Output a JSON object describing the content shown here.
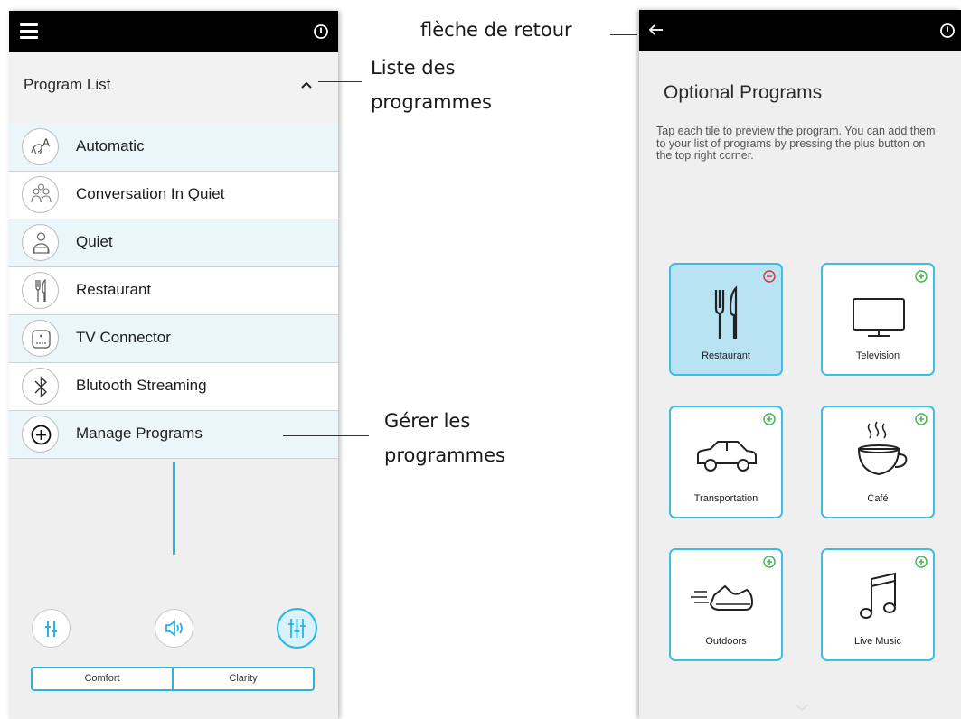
{
  "left_screen": {
    "program_list_title": "Program List",
    "programs": [
      {
        "label": "Automatic",
        "icon": "automatic-icon"
      },
      {
        "label": "Conversation In Quiet",
        "icon": "conversation-icon"
      },
      {
        "label": "Quiet",
        "icon": "quiet-icon"
      },
      {
        "label": "Restaurant",
        "icon": "fork-knife-icon"
      },
      {
        "label": "TV Connector",
        "icon": "tv-connector-icon"
      },
      {
        "label": "Blutooth Streaming",
        "icon": "bluetooth-icon"
      },
      {
        "label": "Manage Programs",
        "icon": "plus-circle-icon"
      }
    ],
    "segment": [
      "Comfort",
      "Clarity"
    ]
  },
  "annotations": {
    "back_arrow": "flèche de retour",
    "program_list_1": "Liste des",
    "program_list_2": "programmes",
    "manage_1": "Gérer les",
    "manage_2": "programmes"
  },
  "right_screen": {
    "title": "Optional Programs",
    "description": "Tap each tile to preview the program. You can add them to your list of programs by pressing the plus button on the top right corner.",
    "tiles": [
      {
        "label": "Restaurant",
        "icon": "fork-knife-icon",
        "badge": "remove",
        "selected": true
      },
      {
        "label": "Television",
        "icon": "television-icon",
        "badge": "add",
        "selected": false
      },
      {
        "label": "Transportation",
        "icon": "car-icon",
        "badge": "add",
        "selected": false
      },
      {
        "label": "Café",
        "icon": "coffee-cup-icon",
        "badge": "add",
        "selected": false
      },
      {
        "label": "Outdoors",
        "icon": "running-shoe-icon",
        "badge": "add",
        "selected": false
      },
      {
        "label": "Live Music",
        "icon": "music-note-icon",
        "badge": "add",
        "selected": false
      }
    ]
  },
  "colors": {
    "accent": "#2cb3df",
    "row_highlight": "#eaf6fa",
    "selected_tile": "#b8e3f3",
    "remove_badge": "#e0303a",
    "add_badge": "#3cb54a"
  }
}
